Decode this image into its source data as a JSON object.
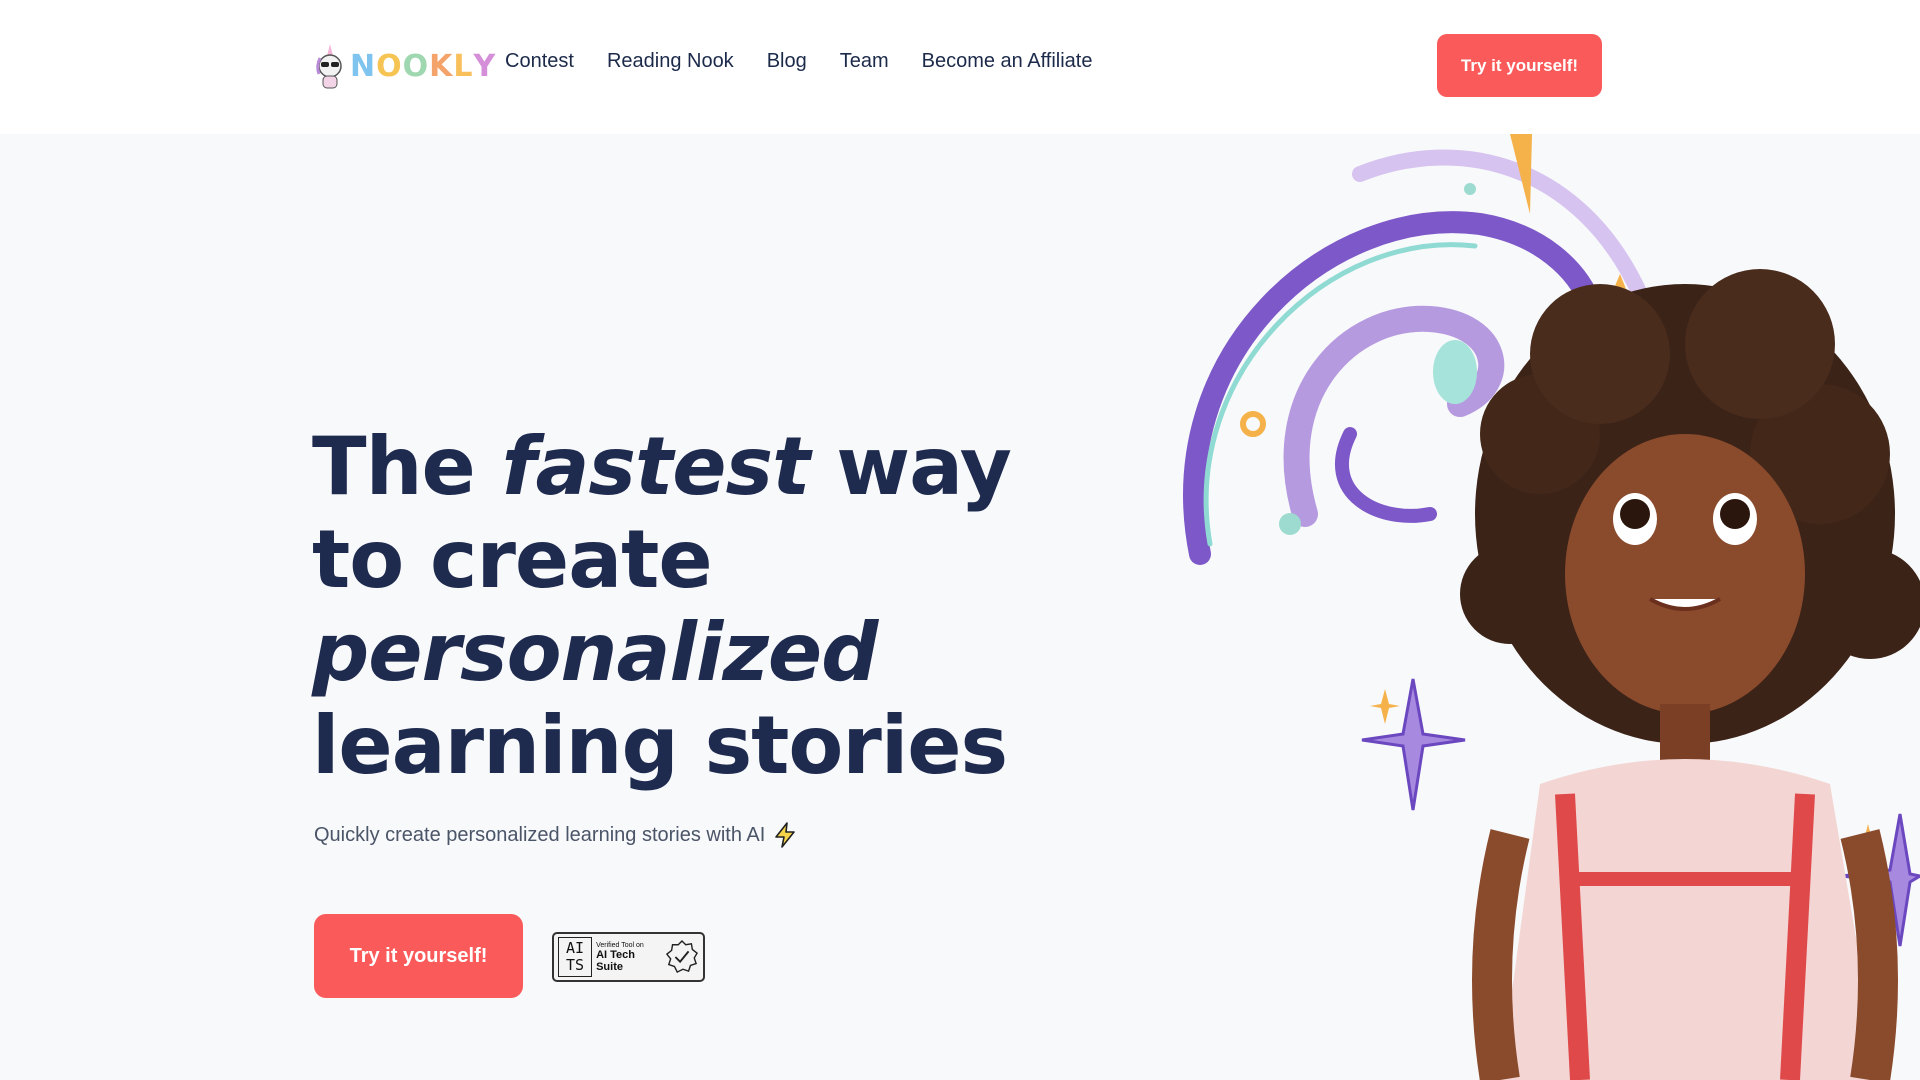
{
  "brand": {
    "letters": [
      "N",
      "O",
      "O",
      "K",
      "L",
      "Y"
    ],
    "letter_colors": [
      "#7fc4ee",
      "#f6c453",
      "#9fd8b0",
      "#f4a36b",
      "#f8bf5a",
      "#d48fd8"
    ]
  },
  "nav": {
    "items": [
      "Contest",
      "Reading Nook",
      "Blog",
      "Team",
      "Become an Affiliate"
    ]
  },
  "header": {
    "cta_label": "Try it yourself!"
  },
  "hero": {
    "headline": {
      "line1_a": "The ",
      "line1_em": "fastest",
      "line1_b": " way",
      "line2": "to create",
      "line3_em": "personalized",
      "line4": "learning stories"
    },
    "subtitle": "Quickly create personalized learning stories with AI",
    "cta_label": "Try it yourself!",
    "badge": {
      "mark_top": "AI",
      "mark_bottom": "TS",
      "small": "Verified Tool on",
      "main": "AI Tech Suite"
    }
  },
  "colors": {
    "accent": "#fb5a5a",
    "text_dark": "#1e2a4e",
    "background": "#f8f9fb"
  },
  "icons": [
    "unicorn-mascot-icon",
    "lightning-bolt-icon",
    "verified-check-icon"
  ]
}
